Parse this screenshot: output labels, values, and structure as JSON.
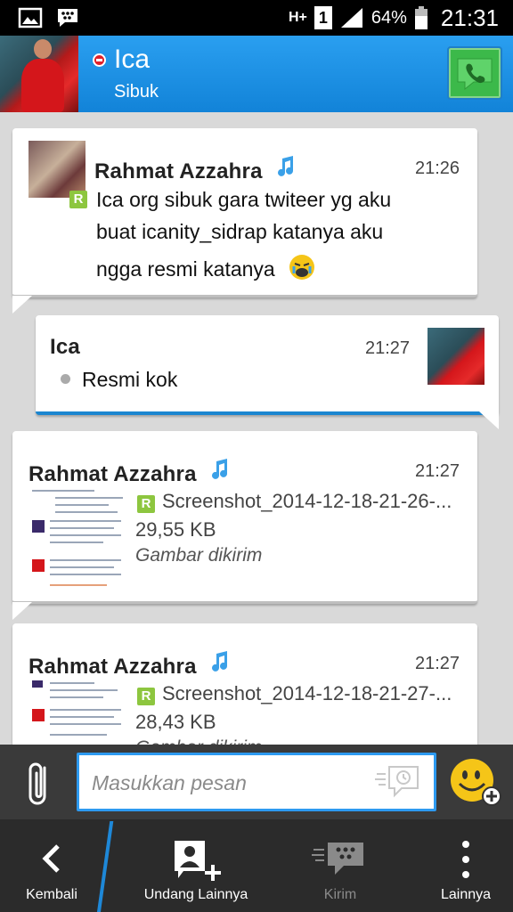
{
  "status_bar": {
    "network": "H+",
    "sim": "1",
    "battery_percent": "64%",
    "time": "21:31",
    "icons": [
      "gallery-icon",
      "bbm-icon",
      "signal-icon",
      "battery-icon"
    ]
  },
  "header": {
    "contact_name": "Ica",
    "contact_status": "Sibuk",
    "status_color": "#e0202a",
    "call_icon": "phone-icon",
    "accent": "#1b8de0"
  },
  "messages": [
    {
      "sender": "Rahmat  Azzahra",
      "time": "21:26",
      "read_marker": "R",
      "lines": [
        "Ica org sibuk gara twiteer yg aku",
        "buat icanity_sidrap katanya aku",
        "ngga resmi katanya"
      ],
      "emoji": "crying-face-icon"
    },
    {
      "sender": "Ica",
      "time": "21:27",
      "text": "Resmi kok"
    },
    {
      "sender": "Rahmat  Azzahra",
      "time": "21:27",
      "read_marker": "R",
      "file_name": "Screenshot_2014-12-18-21-26-...",
      "file_size": "29,55 KB",
      "file_status": "Gambar dikirim"
    },
    {
      "sender": "Rahmat  Azzahra",
      "time": "21:27",
      "read_marker": "R",
      "file_name": "Screenshot_2014-12-18-21-27-...",
      "file_size": "28,43 KB",
      "file_status": "Gambar dikirim"
    }
  ],
  "compose": {
    "placeholder": "Masukkan pesan"
  },
  "bottom_nav": [
    {
      "label": "Kembali",
      "icon": "back-chevron-icon"
    },
    {
      "label": "Undang Lainnya",
      "icon": "invite-contact-icon"
    },
    {
      "label": "Kirim",
      "icon": "send-bbm-icon"
    },
    {
      "label": "Lainnya",
      "icon": "more-vertical-icon"
    }
  ]
}
